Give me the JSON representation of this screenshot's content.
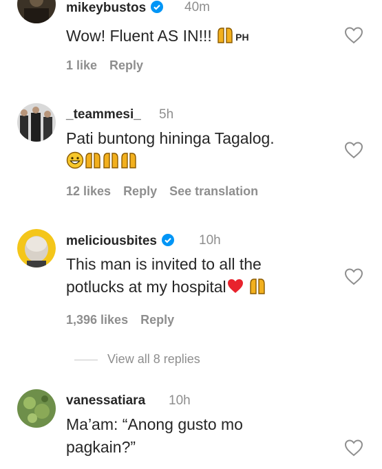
{
  "comments": [
    {
      "username": "mikeybustos",
      "time": "40m",
      "verified": true,
      "text_main": "Wow! Fluent AS IN!!!",
      "text_suffix": "PH",
      "likes": "1 like",
      "reply": "Reply"
    },
    {
      "username": "_teammesi_",
      "time": "5h",
      "verified": false,
      "text_main": "Pati buntong hininga Tagalog.",
      "likes": "12 likes",
      "reply": "Reply",
      "translate": "See translation"
    },
    {
      "username": "meliciousbites",
      "time": "10h",
      "verified": true,
      "text_line1": "This man is invited to all the",
      "text_line2": "potlucks at my hospital",
      "likes": "1,396 likes",
      "reply": "Reply",
      "view_replies": "View all 8 replies"
    },
    {
      "username": "vanessatiara",
      "time": "10h",
      "verified": false,
      "text_line1": "Ma’am: “Anong gusto mo",
      "text_line2": "pagkain?”"
    }
  ],
  "icons": {
    "like": "heart-outline-icon",
    "verified": "verified-badge-icon",
    "praise": "raised-hands-emoji",
    "grin": "grinning-emoji",
    "heart": "red-heart-emoji"
  },
  "colors": {
    "verified": "#0095f6",
    "muted": "#8e8e8e",
    "text": "#262626",
    "heart": "#e8232d"
  }
}
